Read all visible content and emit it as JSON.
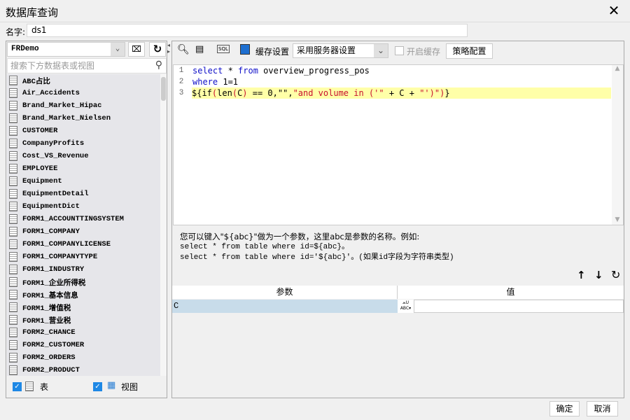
{
  "window": {
    "title": "数据库查询",
    "close_icon": "close-icon"
  },
  "name": {
    "label": "名字:",
    "value": "ds1"
  },
  "left": {
    "connection": "FRDemo",
    "search_placeholder": "搜索下方数据表或视图",
    "tables": [
      "ABC占比",
      "Air_Accidents",
      "Brand_Market_Hipac",
      "Brand_Market_Nielsen",
      "CUSTOMER",
      "CompanyProfits",
      "Cost_VS_Revenue",
      "EMPLOYEE",
      "Equipment",
      "EquipmentDetail",
      "EquipmentDict",
      "FORM1_ACCOUNTTINGSYSTEM",
      "FORM1_COMPANY",
      "FORM1_COMPANYLICENSE",
      "FORM1_COMPANYTYPE",
      "FORM1_INDUSTRY",
      "FORM1_企业所得税",
      "FORM1_基本信息",
      "FORM1_增值税",
      "FORM1_营业税",
      "FORM2_CHANCE",
      "FORM2_CUSTOMER",
      "FORM2_ORDERS",
      "FORM2_PRODUCT"
    ],
    "filter_table": {
      "label": "表",
      "checked": true
    },
    "filter_view": {
      "label": "视图",
      "checked": true
    }
  },
  "toolbar": {
    "cache_label": "缓存设置",
    "cache_option": "采用服务器设置",
    "enable_cache": {
      "label": "开启缓存",
      "checked": false
    },
    "strategy_button": "策略配置"
  },
  "editor": {
    "line_numbers": [
      "1",
      "2",
      "3"
    ],
    "line1": {
      "kw1": "select",
      "op": " * ",
      "kw2": "from",
      "rest": " overview_progress_pos"
    },
    "line2": {
      "kw": "where",
      "rest": " 1=1"
    },
    "line3": {
      "a": "${if",
      "b": "(",
      "c": "len",
      "d": "(",
      "e": "C",
      "f": ")",
      " g": "",
      "h": " == 0,\"\",",
      "i": "\"and volume in ('\"",
      "j": " + C + ",
      "k": "\"')\"",
      "l": ")",
      "m": "}"
    }
  },
  "hint": {
    "line1": "您可以键入\"${abc}\"做为一个参数，这里abc是参数的名称。例如:",
    "line2": "select * from table where id=${abc}。",
    "line3": "select * from table where id='${abc}'。(如果id字段为字符串类型)"
  },
  "params": {
    "headers": [
      "参数",
      "值"
    ],
    "rows": [
      {
        "name": "C",
        "value": "",
        "type_icon": "string-type-icon"
      }
    ]
  },
  "footer": {
    "ok": "确定",
    "cancel": "取消"
  }
}
